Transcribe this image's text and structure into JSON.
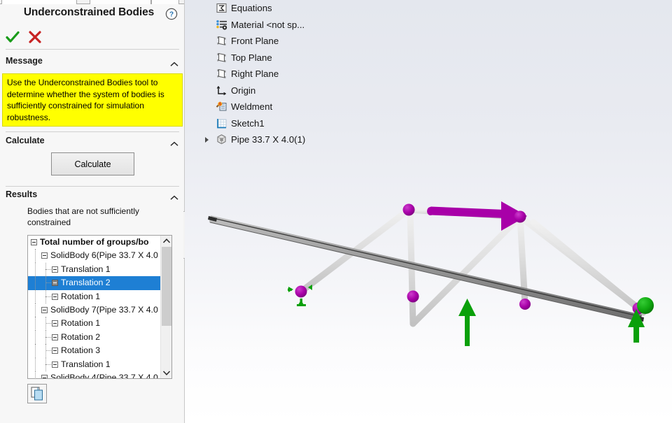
{
  "panel": {
    "title": "Underconstrained Bodies",
    "help_icon": "help-question-icon",
    "ok_label": "✓",
    "cancel_label": "✕",
    "tabs": [
      "",
      "",
      "",
      ""
    ]
  },
  "message": {
    "header": "Message",
    "text": "Use the Underconstrained Bodies tool to determine whether the system of bodies is sufficiently constrained for simulation robustness.",
    "background": "#ffff00"
  },
  "calculate": {
    "header": "Calculate",
    "button_label": "Calculate"
  },
  "results": {
    "header": "Results",
    "description": "Bodies that are not sufficiently constrained",
    "copy_button_icon": "copy-pages-icon",
    "tree": [
      {
        "label": "Total number of groups/bo",
        "depth": 0,
        "bold": true,
        "selected": false,
        "box": "minus"
      },
      {
        "label": "SolidBody 6(Pipe 33.7 X 4.0",
        "depth": 1,
        "bold": false,
        "selected": false,
        "box": "minus"
      },
      {
        "label": "Translation 1",
        "depth": 2,
        "bold": false,
        "selected": false,
        "box": "minus"
      },
      {
        "label": "Translation 2",
        "depth": 2,
        "bold": false,
        "selected": true,
        "box": "filled"
      },
      {
        "label": "Rotation 1",
        "depth": 2,
        "bold": false,
        "selected": false,
        "box": "minus"
      },
      {
        "label": "SolidBody 7(Pipe 33.7 X 4.0",
        "depth": 1,
        "bold": false,
        "selected": false,
        "box": "minus"
      },
      {
        "label": "Rotation 1",
        "depth": 2,
        "bold": false,
        "selected": false,
        "box": "minus"
      },
      {
        "label": "Rotation 2",
        "depth": 2,
        "bold": false,
        "selected": false,
        "box": "minus"
      },
      {
        "label": "Rotation 3",
        "depth": 2,
        "bold": false,
        "selected": false,
        "box": "minus"
      },
      {
        "label": "Translation 1",
        "depth": 2,
        "bold": false,
        "selected": false,
        "box": "minus"
      },
      {
        "label": "SolidBody 4(Pipe 33.7 X 4.0",
        "depth": 1,
        "bold": false,
        "selected": false,
        "box": "minus"
      }
    ],
    "selection_color": "#1e7fd4"
  },
  "feature_tree": [
    {
      "label": "Equations",
      "icon": "equations-sigma-folder-icon",
      "expandable": false
    },
    {
      "label": "Material <not sp...",
      "icon": "material-list-gear-icon",
      "expandable": false
    },
    {
      "label": "Front Plane",
      "icon": "plane-icon",
      "expandable": false
    },
    {
      "label": "Top Plane",
      "icon": "plane-icon",
      "expandable": false
    },
    {
      "label": "Right Plane",
      "icon": "plane-icon",
      "expandable": false
    },
    {
      "label": "Origin",
      "icon": "origin-axes-icon",
      "expandable": false
    },
    {
      "label": "Weldment",
      "icon": "weldment-icon",
      "expandable": false
    },
    {
      "label": "Sketch1",
      "icon": "sketch-grid-icon",
      "expandable": false
    },
    {
      "label": "Pipe 33.7 X 4.0(1)",
      "icon": "solid-body-cube-icon",
      "expandable": true
    }
  ],
  "graphics": {
    "background_top": "#e4e7ee",
    "background_bottom": "#ffffff",
    "colors": {
      "magenta": "#a800a8",
      "green": "#00a000",
      "beam_light": "#dcdcdc",
      "beam_dark": "#8f8f8f"
    },
    "elements": {
      "joint_nodes": 6,
      "force_arrow": "magenta-force-arrow",
      "fixture_left": "green-fixture-symbol",
      "load_arrow_center": "green-up-arrow",
      "load_arrow_right": "green-up-arrow"
    }
  }
}
